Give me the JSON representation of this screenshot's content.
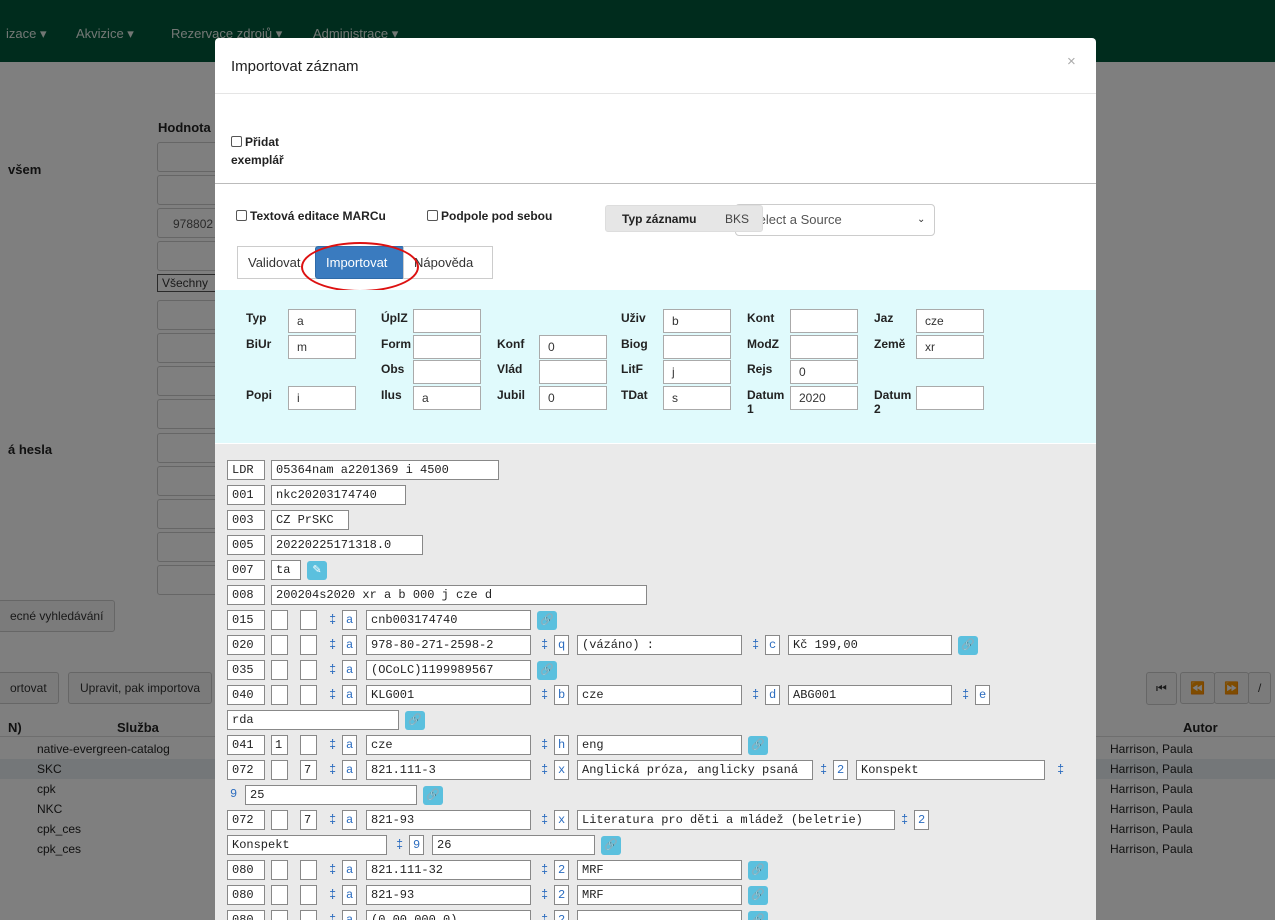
{
  "nav": {
    "items": [
      "izace ▾",
      "Akvizice ▾",
      "Rezervace zdrojů ▾",
      "Administrace ▾"
    ]
  },
  "background": {
    "hodnota_label": "Hodnota",
    "vsem_label": "všem",
    "value_9788": "978802",
    "select_vsechny": "Všechny",
    "hesla_label": "á hesla",
    "search_btn": "ecné vyhledávání",
    "import_btn": "ortovat",
    "edit_import_btn": "Upravit, pak importova",
    "col_n": "N)",
    "col_sluzba": "Služba",
    "col_autor": "Autor",
    "rows": [
      {
        "service": "native-evergreen-catalog",
        "author": "Harrison, Paula"
      },
      {
        "service": "SKC",
        "author": "Harrison, Paula"
      },
      {
        "service": "cpk",
        "author": "Harrison, Paula"
      },
      {
        "service": "NKC",
        "author": "Harrison, Paula"
      },
      {
        "service": "cpk_ces",
        "author": "Harrison, Paula"
      },
      {
        "service": "cpk_ces",
        "author": "Harrison, Paula"
      }
    ],
    "pager": [
      "⏮",
      "⏪",
      "⏩",
      "/"
    ]
  },
  "modal": {
    "title": "Importovat záznam",
    "close": "×",
    "add_copy_label": "Přidat exemplář",
    "text_marc_label": "Textová editace MARCu",
    "subfield_label": "Podpole pod sebou",
    "record_type_label": "Typ záznamu",
    "record_type_value": "BKS",
    "source_placeholder": "Select a Source",
    "tabs": [
      "Validovat",
      "Importovat",
      "Nápověda"
    ]
  },
  "fixed_fields": {
    "Typ": "a",
    "ÚplZ": "",
    "Uživ": "b",
    "Kont": "",
    "Jaz": "cze",
    "BiUr": "m",
    "Form": "",
    "Konf": "0",
    "Biog": "",
    "ModZ": "",
    "Země": "xr",
    "Obs": "",
    "Vlád": "",
    "LitF": "j",
    "Rejs": "0",
    "Popi": "i",
    "Ilus": "a",
    "Jubil": "0",
    "TDat": "s",
    "Datum 1": "2020",
    "Datum 2": ""
  },
  "marc": {
    "ldr": [
      "LDR",
      "05364nam a2201369 i 4500"
    ],
    "c001": [
      "001",
      "nkc20203174740"
    ],
    "c003": [
      "003",
      "CZ PrSKC"
    ],
    "c005": [
      "005",
      "20220225171318.0"
    ],
    "c007": [
      "007",
      "ta"
    ],
    "c008": [
      "008",
      "200204s2020    xr a   b     000 j cze d"
    ],
    "f015": {
      "tag": "015",
      "i1": "",
      "i2": "",
      "s1": [
        "a",
        "cnb003174740"
      ]
    },
    "f020": {
      "tag": "020",
      "s1": [
        "a",
        "978-80-271-2598-2"
      ],
      "s2": [
        "q",
        "(vázáno) :"
      ],
      "s3": [
        "c",
        "Kč 199,00"
      ]
    },
    "f035": {
      "tag": "035",
      "s1": [
        "a",
        "(OCoLC)1199989567"
      ]
    },
    "f040": {
      "tag": "040",
      "s1": [
        "a",
        "KLG001"
      ],
      "s2": [
        "b",
        "cze"
      ],
      "s3": [
        "d",
        "ABG001"
      ],
      "s4": [
        "e",
        "rda"
      ]
    },
    "f041": {
      "tag": "041",
      "i1": "1",
      "s1": [
        "a",
        "cze"
      ],
      "s2": [
        "h",
        "eng"
      ]
    },
    "f072a": {
      "tag": "072",
      "i2": "7",
      "s1": [
        "a",
        "821.111-3"
      ],
      "s2": [
        "x",
        "Anglická próza, anglicky psaná"
      ],
      "s3": [
        "2",
        "Konspekt"
      ],
      "s4": [
        "9",
        "25"
      ]
    },
    "f072b": {
      "tag": "072",
      "i2": "7",
      "s1": [
        "a",
        "821-93"
      ],
      "s2": [
        "x",
        "Literatura pro děti a mládež (beletrie)"
      ],
      "s3": [
        "2",
        "Konspekt"
      ],
      "s4": [
        "9",
        "26"
      ]
    },
    "f080a": {
      "tag": "080",
      "s1": [
        "a",
        "821.111-32"
      ],
      "s2": [
        "2",
        "MRF"
      ]
    },
    "f080b": {
      "tag": "080",
      "s1": [
        "a",
        "821-93"
      ],
      "s2": [
        "2",
        "MRF"
      ]
    },
    "f080c": {
      "tag": "080",
      "s1": [
        "a",
        "(0.00.000.0)"
      ],
      "s2": [
        "2",
        ""
      ]
    },
    "delim": "‡",
    "link_icon": "link-icon",
    "edit_icon": "edit-icon"
  }
}
